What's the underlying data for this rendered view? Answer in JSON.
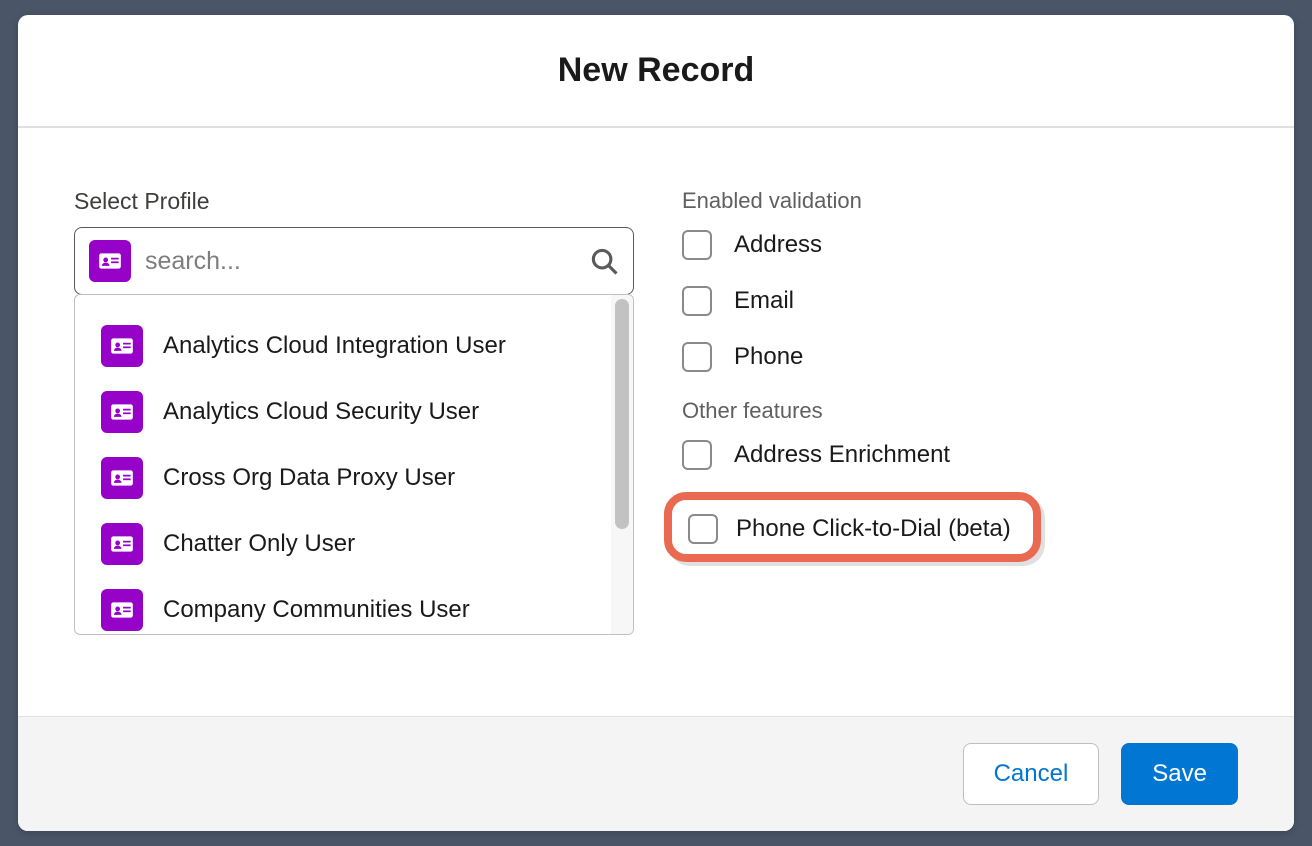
{
  "modal": {
    "title": "New Record"
  },
  "profile": {
    "label": "Select Profile",
    "placeholder": "search...",
    "options": [
      "Analytics Cloud Integration User",
      "Analytics Cloud Security User",
      "Cross Org Data Proxy User",
      "Chatter Only User",
      "Company Communities User"
    ]
  },
  "validation": {
    "label": "Enabled validation",
    "items": [
      "Address",
      "Email",
      "Phone"
    ]
  },
  "features": {
    "label": "Other features",
    "items": [
      "Address Enrichment",
      "Phone Click-to-Dial (beta)"
    ]
  },
  "footer": {
    "cancel": "Cancel",
    "save": "Save"
  },
  "icons": {
    "badge": "contact-card-icon",
    "search": "search-icon"
  }
}
